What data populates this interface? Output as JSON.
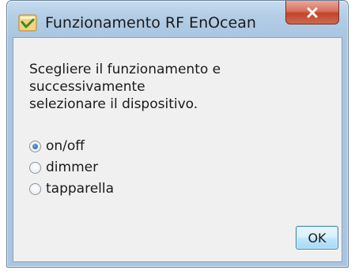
{
  "window": {
    "title": "Funzionamento RF EnOcean",
    "close_icon": "close-icon",
    "app_icon": "app-icon"
  },
  "dialog": {
    "message": "Scegliere il funzionamento e successivamente\nselezionare il dispositivo.",
    "options": [
      {
        "label": "on/off",
        "selected": true
      },
      {
        "label": "dimmer",
        "selected": false
      },
      {
        "label": "tapparella",
        "selected": false
      }
    ],
    "ok_label": "OK"
  },
  "colors": {
    "title_bar": "#b3cde5",
    "close_button": "#c2432d",
    "client_bg": "#f0f0f0",
    "radio_selected": "#1d5aa8"
  }
}
